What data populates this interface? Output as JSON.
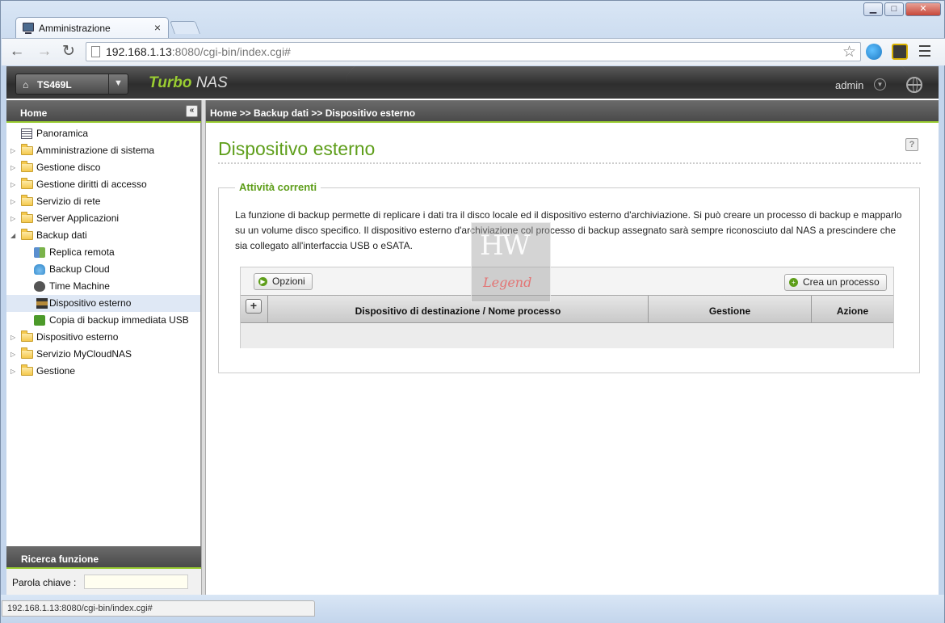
{
  "browser": {
    "tab_title": "Amministrazione",
    "tab_close": "×",
    "url_host": "192.168.1.13",
    "url_rest": ":8080/cgi-bin/index.cgi#",
    "status_url": "192.168.1.13:8080/cgi-bin/index.cgi#"
  },
  "header": {
    "device_name": "TS469L",
    "brand_turbo": "Turbo",
    "brand_nas": " NAS",
    "user": "admin"
  },
  "sidebar": {
    "title": "Home",
    "items": [
      {
        "label": "Panoramica"
      },
      {
        "label": "Amministrazione di sistema"
      },
      {
        "label": "Gestione disco"
      },
      {
        "label": "Gestione diritti di accesso"
      },
      {
        "label": "Servizio di rete"
      },
      {
        "label": "Server Applicazioni"
      },
      {
        "label": "Backup dati"
      },
      {
        "label": "Replica remota"
      },
      {
        "label": "Backup Cloud"
      },
      {
        "label": "Time Machine"
      },
      {
        "label": "Dispositivo esterno"
      },
      {
        "label": "Copia di backup immediata USB"
      },
      {
        "label": "Dispositivo esterno"
      },
      {
        "label": "Servizio MyCloudNAS"
      },
      {
        "label": "Gestione"
      }
    ],
    "search": {
      "title": "Ricerca funzione",
      "keyword_label": "Parola chiave :",
      "keyword_value": ""
    }
  },
  "main": {
    "breadcrumb": "Home >> Backup dati >> Dispositivo esterno",
    "page_title": "Dispositivo esterno",
    "help": "?",
    "section_title": "Attività correnti",
    "description": "La funzione di backup permette di replicare i dati tra il disco locale ed il dispositivo esterno d'archiviazione. Si può creare un processo di backup e mapparlo su un volume disco specifico. Il dispositivo esterno d'archiviazione col processo di backup assegnato sarà sempre riconosciuto dal NAS a prescindere che sia collegato all'interfaccia USB o eSATA.",
    "options_button": "Opzioni",
    "create_button": "Crea un processo",
    "columns": [
      "Dispositivo di destinazione / Nome processo",
      "Gestione",
      "Azione"
    ]
  },
  "watermark": {
    "line1": "HW",
    "line2": "Legend"
  },
  "colors": {
    "accent": "#5e9e1a",
    "header_dark": "#3a3a3a",
    "selected_row": "#dfe8f5"
  }
}
